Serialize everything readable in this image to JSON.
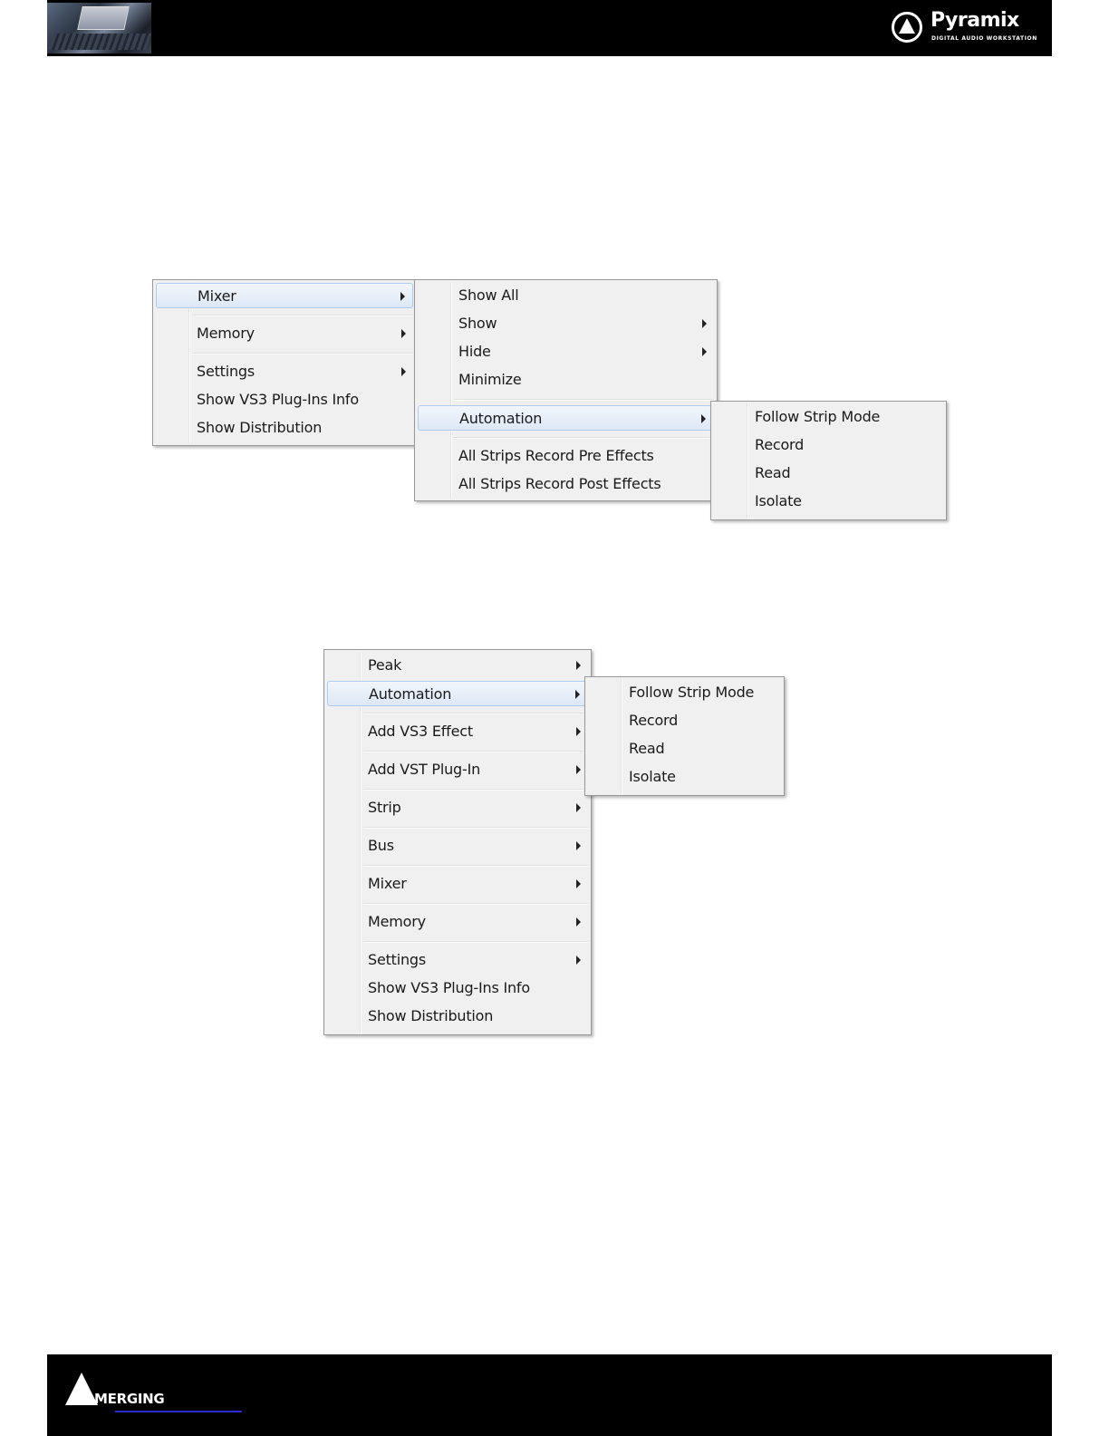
{
  "header": {
    "brand_name": "Pyramix",
    "brand_tagline": "DIGITAL AUDIO WORKSTATION"
  },
  "footer": {
    "company_name": "MERGING"
  },
  "menu1": {
    "main": {
      "items": [
        {
          "label": "Mixer",
          "submenu": true,
          "highlighted": true
        },
        {
          "label": "Memory",
          "submenu": true
        },
        {
          "label": "Settings",
          "submenu": true
        },
        {
          "label": "Show VS3 Plug-Ins Info",
          "submenu": false
        },
        {
          "label": "Show Distribution",
          "submenu": false
        }
      ]
    },
    "mixer_submenu": {
      "items": [
        {
          "label": "Show All",
          "submenu": false
        },
        {
          "label": "Show",
          "submenu": true
        },
        {
          "label": "Hide",
          "submenu": true
        },
        {
          "label": "Minimize",
          "submenu": false
        },
        {
          "label": "Automation",
          "submenu": true,
          "highlighted": true
        },
        {
          "label": "All Strips Record Pre Effects",
          "submenu": false
        },
        {
          "label": "All Strips Record Post Effects",
          "submenu": false
        }
      ]
    },
    "automation_submenu": {
      "items": [
        {
          "label": "Follow Strip Mode"
        },
        {
          "label": "Record"
        },
        {
          "label": "Read"
        },
        {
          "label": "Isolate"
        }
      ]
    }
  },
  "menu2": {
    "main": {
      "items": [
        {
          "label": "Peak",
          "submenu": true
        },
        {
          "label": "Automation",
          "submenu": true,
          "highlighted": true
        },
        {
          "label": "Add VS3 Effect",
          "submenu": true
        },
        {
          "label": "Add VST Plug-In",
          "submenu": true
        },
        {
          "label": "Strip",
          "submenu": true
        },
        {
          "label": "Bus",
          "submenu": true
        },
        {
          "label": "Mixer",
          "submenu": true
        },
        {
          "label": "Memory",
          "submenu": true
        },
        {
          "label": "Settings",
          "submenu": true
        },
        {
          "label": "Show VS3 Plug-Ins Info",
          "submenu": false
        },
        {
          "label": "Show Distribution",
          "submenu": false
        }
      ]
    },
    "automation_submenu": {
      "items": [
        {
          "label": "Follow Strip Mode"
        },
        {
          "label": "Record"
        },
        {
          "label": "Read"
        },
        {
          "label": "Isolate"
        }
      ]
    }
  },
  "colors": {
    "menu_background": "#f0f0f0",
    "highlight_border": "#aeccf1",
    "highlight_fill": "#dde8f6",
    "bar_background": "#000000"
  }
}
